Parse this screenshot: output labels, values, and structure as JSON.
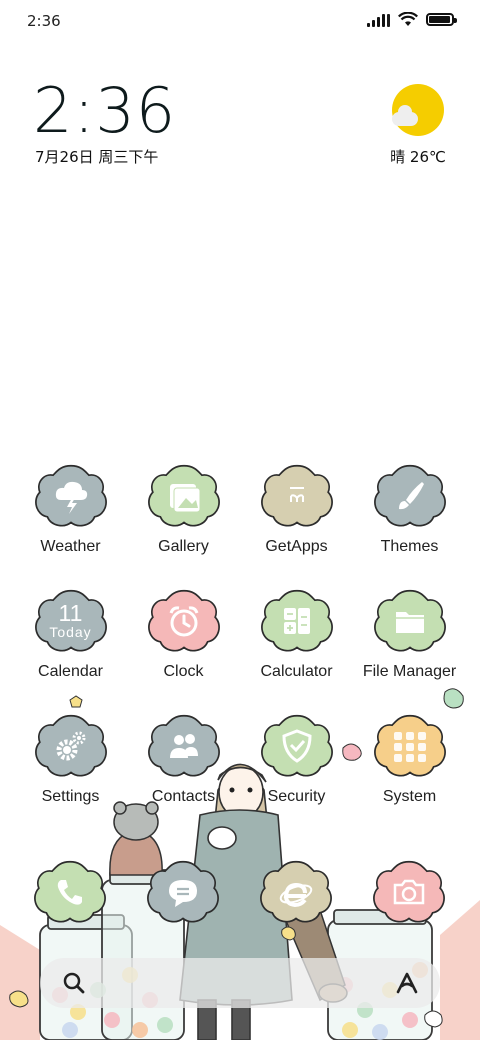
{
  "status_bar": {
    "time": "2:36",
    "battery_level": 0.95,
    "signal_bars": 4,
    "icons": [
      "signal-icon",
      "wifi-icon",
      "battery-icon"
    ]
  },
  "clock_widget": {
    "time": "2:36",
    "date": "7月26日 周三下午"
  },
  "weather_widget": {
    "condition_text": "晴 26℃",
    "icon": "sun-icon"
  },
  "apps": [
    {
      "label": "Weather",
      "icon": "cloud-lightning-icon",
      "color": "#a9b7ba"
    },
    {
      "label": "Gallery",
      "icon": "photo-icon",
      "color": "#c4dfb2"
    },
    {
      "label": "GetApps",
      "icon": "shopping-bag-icon",
      "color": "#d6cfb0"
    },
    {
      "label": "Themes",
      "icon": "brush-icon",
      "color": "#a9b7ba"
    },
    {
      "label": "Calendar",
      "icon": "calendar-icon",
      "color": "#a9b7ba",
      "date_number": "11",
      "day_text": "Today"
    },
    {
      "label": "Clock",
      "icon": "alarm-clock-icon",
      "color": "#f5b8b8"
    },
    {
      "label": "Calculator",
      "icon": "calculator-icon",
      "color": "#c4dfb2"
    },
    {
      "label": "File Manager",
      "icon": "folder-icon",
      "color": "#c4dfb2"
    },
    {
      "label": "Settings",
      "icon": "gears-icon",
      "color": "#a9b7ba"
    },
    {
      "label": "Contacts",
      "icon": "people-icon",
      "color": "#a9b7ba"
    },
    {
      "label": "Security",
      "icon": "shield-check-icon",
      "color": "#c4dfb2"
    },
    {
      "label": "System",
      "icon": "folder-grid-icon",
      "color": "#f6cf8a"
    }
  ],
  "dock": [
    {
      "name": "phone",
      "icon": "phone-icon",
      "color": "#c4dfb2"
    },
    {
      "name": "messages",
      "icon": "chat-bubble-icon",
      "color": "#a9b7ba"
    },
    {
      "name": "browser",
      "icon": "browser-e-icon",
      "color": "#d6cfb0"
    },
    {
      "name": "camera",
      "icon": "camera-icon",
      "color": "#f5b8b8"
    }
  ],
  "search_bar": {
    "search_icon": "search-icon",
    "assistant_icon": "assistant-a-icon"
  }
}
